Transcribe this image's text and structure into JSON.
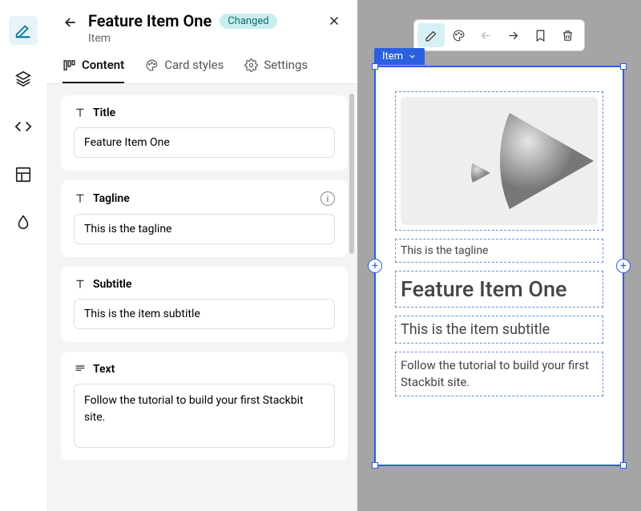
{
  "rail": {
    "items": [
      "edit",
      "layers",
      "code",
      "layout",
      "drop"
    ]
  },
  "header": {
    "title": "Feature Item One",
    "badge": "Changed",
    "subtitle": "Item"
  },
  "tabs": [
    {
      "label": "Content",
      "icon": "content"
    },
    {
      "label": "Card styles",
      "icon": "palette"
    },
    {
      "label": "Settings",
      "icon": "gear"
    }
  ],
  "fields": {
    "title": {
      "label": "Title",
      "value": "Feature Item One"
    },
    "tagline": {
      "label": "Tagline",
      "value": "This is the tagline"
    },
    "subtitle": {
      "label": "Subtitle",
      "value": "This is the item subtitle"
    },
    "text": {
      "label": "Text",
      "value": "Follow the tutorial to build your first Stackbit site."
    }
  },
  "toolbar": [
    "edit",
    "palette",
    "back",
    "forward",
    "bookmark",
    "trash"
  ],
  "preview": {
    "label": "Item",
    "tagline": "This is the tagline",
    "title": "Feature Item One",
    "subtitle": "This is the item subtitle",
    "text": "Follow the tutorial to build your first Stackbit site."
  }
}
